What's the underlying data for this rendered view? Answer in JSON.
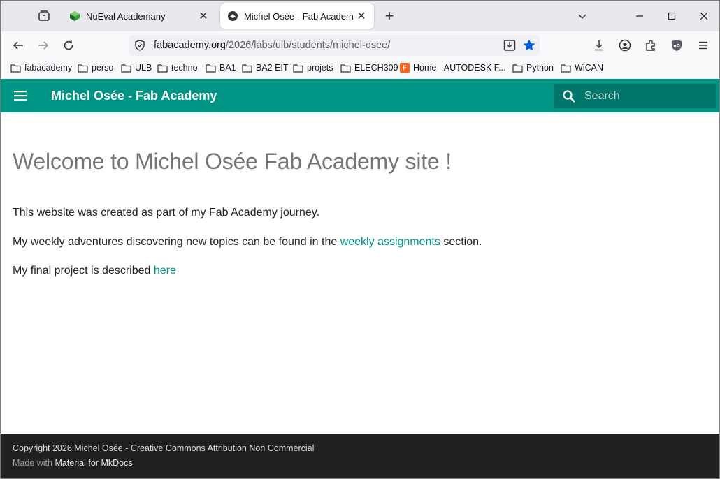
{
  "browser": {
    "tabs": [
      {
        "title": "NuEval Academany",
        "active": false
      },
      {
        "title": "Michel Osée - Fab Academy",
        "active": true
      }
    ],
    "url": {
      "domain": "fabacademy.org",
      "path": "/2026/labs/ulb/students/michel-osee/"
    },
    "bookmarks": [
      {
        "label": "fabacademy",
        "icon": "folder-icon"
      },
      {
        "label": "perso",
        "icon": "folder-icon"
      },
      {
        "label": "ULB",
        "icon": "folder-icon"
      },
      {
        "label": "techno",
        "icon": "folder-icon"
      },
      {
        "label": "BA1",
        "icon": "folder-icon"
      },
      {
        "label": "BA2 EIT",
        "icon": "folder-icon"
      },
      {
        "label": "projets",
        "icon": "folder-icon"
      },
      {
        "label": "ELECH309",
        "icon": "folder-icon"
      },
      {
        "label": "Home - AUTODESK F...",
        "icon": "autodesk-favicon"
      },
      {
        "label": "Python",
        "icon": "folder-icon"
      },
      {
        "label": "WiCAN",
        "icon": "folder-icon"
      }
    ],
    "colors": {
      "starred": "#0060df",
      "tabstrip": "#e9e9ed"
    }
  },
  "site": {
    "title": "Michel Osée - Fab Academy",
    "search_placeholder": "Search",
    "heading": "Welcome to Michel Osée Fab Academy site !",
    "p1": "This website was created as part of my Fab Academy journey.",
    "p2_before": "My weekly adventures discovering new topics can be found in the ",
    "p2_link": "weekly assignments",
    "p2_after": " section.",
    "p3_before": "My final project is described ",
    "p3_link": "here",
    "colors": {
      "primary": "#009485",
      "search_bg": "#00766a",
      "footer_bg": "#202020"
    }
  },
  "footer": {
    "copyright": "Copyright 2026 Michel Osée - Creative Commons Attribution Non Commercial",
    "made_with": "Made with ",
    "made_with_link": "Material for MkDocs"
  }
}
